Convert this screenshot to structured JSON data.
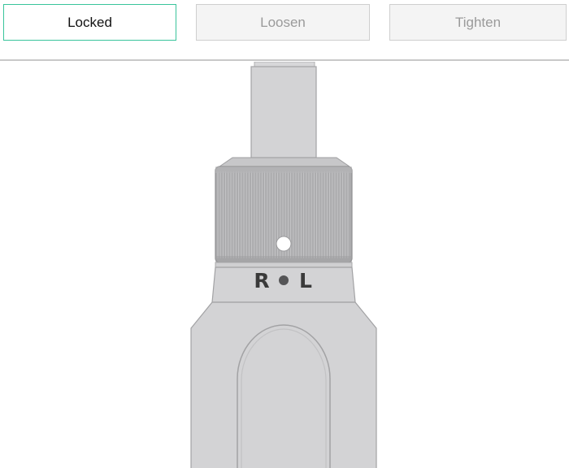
{
  "toolbar": {
    "buttons": [
      {
        "label": "Locked",
        "state": "active"
      },
      {
        "label": "Loosen",
        "state": "inactive"
      },
      {
        "label": "Tighten",
        "state": "inactive"
      }
    ]
  },
  "tool": {
    "direction_labels": {
      "right": "R",
      "left": "L"
    }
  },
  "colors": {
    "active_border": "#39c49b",
    "tool_body": "#d3d3d5",
    "collar": "#a9a9ab",
    "outline": "#9c9c9e"
  }
}
